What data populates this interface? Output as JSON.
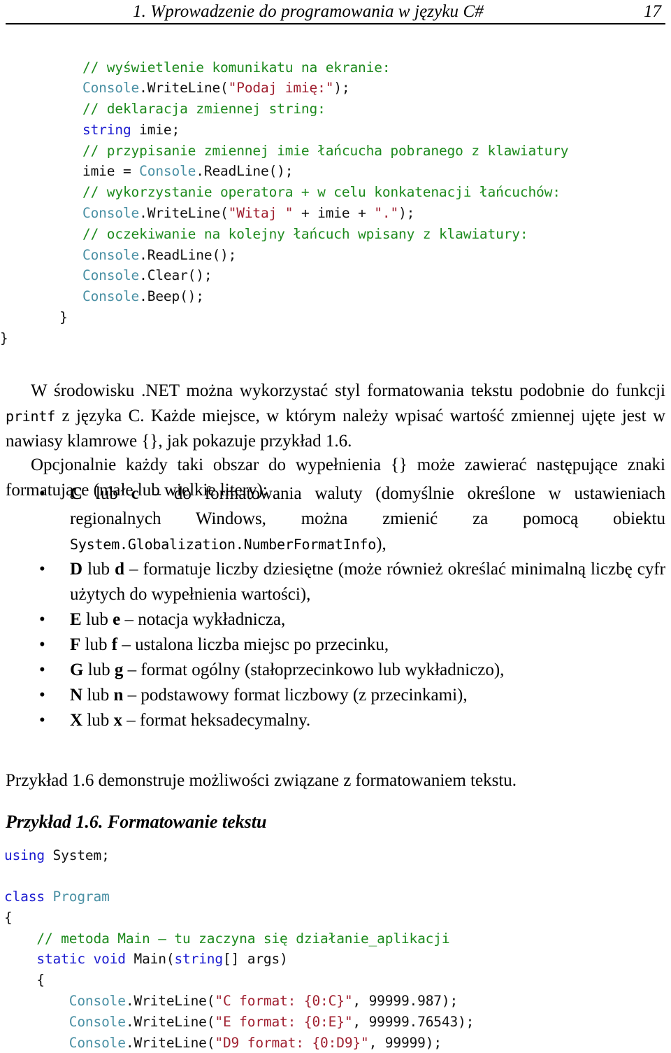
{
  "header": {
    "title": "1. Wprowadzenie do programowania w języku C#",
    "page_number": "17"
  },
  "code_top": {
    "lines": [
      "// wyświetlenie komunikatu na ekranie:",
      "Console.WriteLine(\"Podaj imię:\");",
      "// deklaracja zmiennej string:",
      "string imie;",
      "// przypisanie zmiennej imie łańcucha pobranego z klawiatury",
      "imie = Console.ReadLine();",
      "// wykorzystanie operatora + w celu konkatenacji łańcuchów:",
      "Console.WriteLine(\"Witaj \" + imie + \".\");",
      "// oczekiwanie na kolejny łańcuch wpisany z klawiatury:",
      "Console.ReadLine();",
      "Console.Clear();",
      "Console.Beep();",
      "    }",
      "}"
    ],
    "tokens": {
      "l1_comment": "// wyświetlenie komunikatu na ekranie:",
      "l2_type": "Console",
      "l2_plain_a": ".WriteLine(",
      "l2_string": "\"Podaj imię:\"",
      "l2_plain_b": ");",
      "l3_comment": "// deklaracja zmiennej string:",
      "l4_keyword": "string",
      "l4_plain": " imie;",
      "l5_comment": "// przypisanie zmiennej imie łańcucha pobranego z klawiatury",
      "l6_plain_a": "imie = ",
      "l6_type": "Console",
      "l6_plain_b": ".ReadLine();",
      "l7_comment": "// wykorzystanie operatora + w celu konkatenacji łańcuchów:",
      "l8_type": "Console",
      "l8_plain_a": ".WriteLine(",
      "l8_string_a": "\"Witaj \"",
      "l8_plain_b": " + imie + ",
      "l8_string_b": "\".\"",
      "l8_plain_c": ");",
      "l9_comment": "// oczekiwanie na kolejny łańcuch wpisany z klawiatury:",
      "l10_type": "Console",
      "l10_plain": ".ReadLine();",
      "l11_type": "Console",
      "l11_plain": ".Clear();",
      "l12_type": "Console",
      "l12_plain": ".Beep();",
      "l13_brace": "  }",
      "l14_brace": "}"
    }
  },
  "paragraphs": {
    "net_formatting": {
      "part_a": "W środowisku .NET można wykorzystać styl formatowania tekstu podobnie do funkcji ",
      "mono": "printf",
      "part_b": " z języka C. Każde miejsce, w którym należy wpisać wartość zmiennej ujęte jest w nawiasy klamrowe {}, jak pokazuje przykład 1.6."
    },
    "optional_intro": "Opcjonalnie każdy taki obszar do wypełnienia {} może zawierać następujące znaki formatujące (małe lub wielkie litery):",
    "example_intro": "Przykład 1.6 demonstruje możliwości związane z formatowaniem tekstu."
  },
  "format_list": {
    "bullet_glyph": "•",
    "items": [
      {
        "code_upper": "C",
        "sep1": " lub ",
        "code_lower": "c",
        "desc_a": " – do formatowania waluty (domyślnie określone w ustawieniach regionalnych Windows, można zmienić za pomocą obiektu ",
        "mono": "System.Globalization.NumberFormatInfo",
        "desc_b": "),",
        "justify_first": true
      },
      {
        "code_upper": "D",
        "sep1": " lub ",
        "code_lower": "d",
        "desc_a": " – formatuje liczby dziesiętne (może również określać minimalną liczbę cyfr użytych do wypełnienia wartości),",
        "mono": "",
        "desc_b": "",
        "justify_first": true
      },
      {
        "code_upper": "E",
        "sep1": " lub ",
        "code_lower": "e",
        "desc_a": " – notacja wykładnicza,",
        "mono": "",
        "desc_b": "",
        "justify_first": false
      },
      {
        "code_upper": "F",
        "sep1": " lub ",
        "code_lower": "f",
        "desc_a": " – ustalona liczba miejsc po przecinku,",
        "mono": "",
        "desc_b": "",
        "justify_first": false
      },
      {
        "code_upper": "G",
        "sep1": " lub ",
        "code_lower": "g",
        "desc_a": " – format ogólny (stałoprzecinkowo lub wykładniczo),",
        "mono": "",
        "desc_b": "",
        "justify_first": false
      },
      {
        "code_upper": "N",
        "sep1": " lub ",
        "code_lower": "n",
        "desc_a": " – podstawowy format liczbowy (z przecinkami),",
        "mono": "",
        "desc_b": "",
        "justify_first": false
      },
      {
        "code_upper": "X",
        "sep1": " lub ",
        "code_lower": "x",
        "desc_a": " – format heksadecymalny.",
        "mono": "",
        "desc_b": "",
        "justify_first": false
      }
    ]
  },
  "example_heading": "Przykład 1.6. Formatowanie tekstu",
  "code_bottom": {
    "tokens": {
      "l1_keyword": "using",
      "l1_plain": " System;",
      "l3_keyword": "class",
      "l3_type": " Program",
      "l4_brace": "{",
      "l5_comment": "    // metoda Main – tu zaczyna się działanie_aplikacji",
      "l6_indent": "    ",
      "l6_keyword_a": "static",
      "l6_plain_a": " ",
      "l6_keyword_b": "void",
      "l6_plain_b": " Main(",
      "l6_keyword_c": "string",
      "l6_plain_c": "[] args)",
      "l7_brace": "    {",
      "l8_indent": "        ",
      "l8_type": "Console",
      "l8_plain_a": ".WriteLine(",
      "l8_string": "\"C format: {0:C}\"",
      "l8_plain_b": ", 99999.987);",
      "l9_indent": "        ",
      "l9_type": "Console",
      "l9_plain_a": ".WriteLine(",
      "l9_string": "\"E format: {0:E}\"",
      "l9_plain_b": ", 99999.76543);",
      "l10_indent": "        ",
      "l10_type": "Console",
      "l10_plain_a": ".WriteLine(",
      "l10_string": "\"D9 format: {0:D9}\"",
      "l10_plain_b": ", 99999);"
    }
  },
  "colors": {
    "comment": "#1d8a1d",
    "keyword": "#1a1ad0",
    "type": "#4a90a4",
    "string": "#a02030",
    "plain": "#111111",
    "page_background": "#ffffff",
    "text": "#000000"
  }
}
